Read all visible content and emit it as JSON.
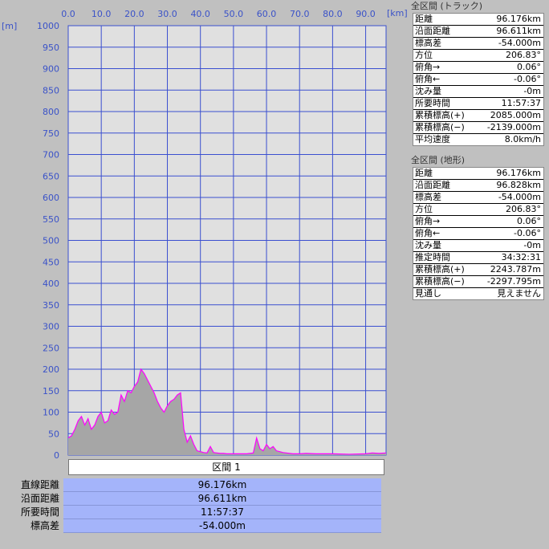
{
  "chart_data": {
    "type": "area",
    "x_unit": "[km]",
    "y_unit": "[m]",
    "xlim": [
      0,
      96.176
    ],
    "ylim": [
      0,
      1000
    ],
    "x_ticks": [
      "0.0",
      "10.0",
      "20.0",
      "30.0",
      "40.0",
      "50.0",
      "60.0",
      "70.0",
      "80.0",
      "90.0"
    ],
    "y_ticks": [
      "1000",
      "950",
      "900",
      "850",
      "800",
      "750",
      "700",
      "650",
      "600",
      "550",
      "500",
      "450",
      "400",
      "350",
      "300",
      "250",
      "200",
      "150",
      "100",
      "50",
      "0"
    ],
    "series": [
      {
        "x": [
          0,
          1,
          2,
          3,
          4,
          5,
          6,
          7,
          8,
          9,
          10,
          11,
          12,
          13,
          14,
          15,
          16,
          17,
          18,
          19,
          20,
          21,
          22,
          23,
          24,
          25,
          26,
          27,
          28,
          29,
          30,
          31,
          32,
          33,
          34,
          35,
          36,
          37,
          38,
          39,
          40,
          41,
          42,
          43,
          44,
          45,
          46,
          47,
          48,
          50,
          52,
          54,
          56,
          57,
          58,
          59,
          60,
          61,
          62,
          63,
          64,
          65,
          66,
          68,
          70,
          72,
          75,
          80,
          85,
          90,
          92,
          94,
          96.176
        ],
        "y": [
          40,
          45,
          60,
          80,
          90,
          70,
          85,
          60,
          70,
          90,
          100,
          75,
          80,
          105,
          95,
          100,
          140,
          125,
          150,
          145,
          160,
          170,
          200,
          190,
          175,
          160,
          145,
          125,
          110,
          100,
          115,
          125,
          130,
          140,
          145,
          60,
          30,
          45,
          25,
          10,
          8,
          6,
          5,
          20,
          6,
          5,
          4,
          4,
          3,
          3,
          3,
          3,
          5,
          40,
          15,
          10,
          25,
          15,
          20,
          10,
          8,
          6,
          5,
          3,
          3,
          4,
          3,
          3,
          2,
          3,
          5,
          4,
          5
        ]
      }
    ]
  },
  "section": {
    "header": "区間 1",
    "labels": [
      "直線距離",
      "沿面距離",
      "所要時間",
      "標高差"
    ],
    "values": [
      "96.176km",
      "96.611km",
      "11:57:37",
      "-54.000m"
    ]
  },
  "track_panel": {
    "title": "全区間 (トラック)",
    "rows": [
      {
        "label": "距離",
        "value": "96.176km"
      },
      {
        "label": "沿面距離",
        "value": "96.611km"
      },
      {
        "label": "標高差",
        "value": "-54.000m"
      },
      {
        "label": "方位",
        "value": "206.83°"
      },
      {
        "label": "俯角→",
        "value": "0.06°"
      },
      {
        "label": "俯角←",
        "value": "-0.06°"
      },
      {
        "label": "沈み量",
        "value": "-0m"
      },
      {
        "label": "所要時間",
        "value": "11:57:37"
      },
      {
        "label": "累積標高(+)",
        "value": "2085.000m"
      },
      {
        "label": "累積標高(−)",
        "value": "-2139.000m"
      },
      {
        "label": "平均速度",
        "value": "8.0km/h"
      }
    ]
  },
  "terrain_panel": {
    "title": "全区間 (地形)",
    "rows": [
      {
        "label": "距離",
        "value": "96.176km"
      },
      {
        "label": "沿面距離",
        "value": "96.828km"
      },
      {
        "label": "標高差",
        "value": "-54.000m"
      },
      {
        "label": "方位",
        "value": "206.83°"
      },
      {
        "label": "俯角→",
        "value": "0.06°"
      },
      {
        "label": "俯角←",
        "value": "-0.06°"
      },
      {
        "label": "沈み量",
        "value": "-0m"
      },
      {
        "label": "推定時間",
        "value": "34:32:31"
      },
      {
        "label": "累積標高(+)",
        "value": "2243.787m"
      },
      {
        "label": "累積標高(−)",
        "value": "-2297.795m"
      },
      {
        "label": "見通し",
        "value": "見えません"
      }
    ]
  },
  "colors": {
    "plot_bg": "#e0e0e0",
    "grid": "#3a4fd0",
    "area_fill": "#a6a6a6",
    "line": "#ff00ff",
    "axis_text": "#3a52c8",
    "stat_bg": "#a4b4fa"
  }
}
